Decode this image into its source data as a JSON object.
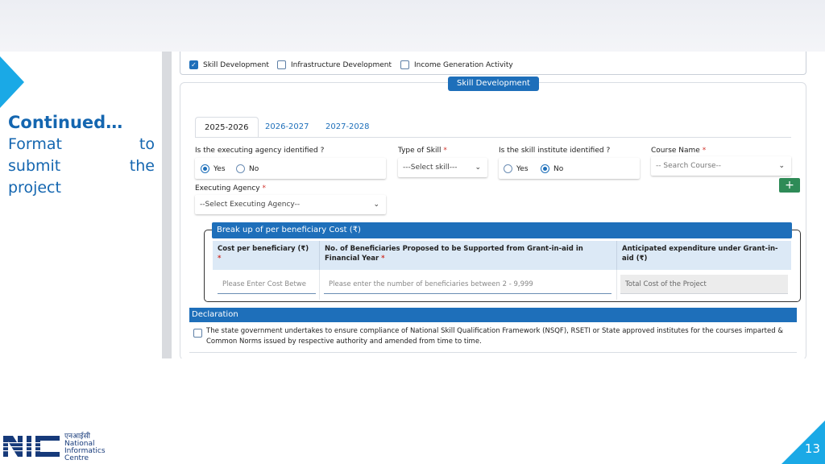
{
  "slide": {
    "continued": "Continued…",
    "body_lines": [
      "Format to",
      "submit the",
      "project"
    ],
    "page_number": "13",
    "logo": {
      "hindi": "एनआईसी",
      "line1": "National",
      "line2": "Informatics",
      "line3": "Centre",
      "accent_color": "#1aa9e6",
      "brand_color": "#163a7a"
    }
  },
  "form": {
    "activities": [
      {
        "label": "Skill Development",
        "checked": true
      },
      {
        "label": "Infrastructure Development",
        "checked": false
      },
      {
        "label": "Income Generation Activity",
        "checked": false
      }
    ],
    "section_title": "Skill Development",
    "tabs": [
      {
        "label": "2025-2026",
        "active": true
      },
      {
        "label": "2026-2027",
        "active": false
      },
      {
        "label": "2027-2028",
        "active": false
      }
    ],
    "agency_identified": {
      "label": "Is the executing agency identified ?",
      "options": [
        "Yes",
        "No"
      ],
      "selected": "Yes"
    },
    "type_of_skill": {
      "label": "Type of Skill",
      "required_mark": "*",
      "value": "---Select skill---"
    },
    "institute_identified": {
      "label": "Is the skill institute identified ?",
      "options": [
        "Yes",
        "No"
      ],
      "selected": "No"
    },
    "course_name": {
      "label": "Course Name",
      "required_mark": "*",
      "placeholder": "-- Search Course--"
    },
    "add_button": "+",
    "executing_agency": {
      "label": "Executing Agency",
      "required_mark": "*",
      "value": "--Select Executing Agency--"
    },
    "breakup": {
      "title": "Break up of per beneficiary Cost (₹)",
      "headers": [
        {
          "text": "Cost per beneficiary (₹)",
          "required_mark": "*"
        },
        {
          "text": "No. of Beneficiaries Proposed to be Supported from Grant-in-aid in Financial Year",
          "required_mark": "*"
        },
        {
          "text": "Anticipated expenditure under Grant-in-aid (₹)",
          "required_mark": ""
        }
      ],
      "inputs": [
        "Please Enter Cost Betwe",
        "Please enter the number of beneficiaries between 2 - 9,999",
        "Total Cost of the Project"
      ]
    },
    "declaration": {
      "title": "Declaration",
      "text": "The state government undertakes to ensure compliance of National Skill Qualification Framework (NSQF), RSETI or State approved institutes for the courses imparted & Common Norms issued by respective authority and amended from time to time.",
      "checked": false
    },
    "colors": {
      "primary": "#1e6fba",
      "success": "#2e8b57",
      "required": "#d0342c",
      "header_fill": "#dce9f6"
    }
  }
}
